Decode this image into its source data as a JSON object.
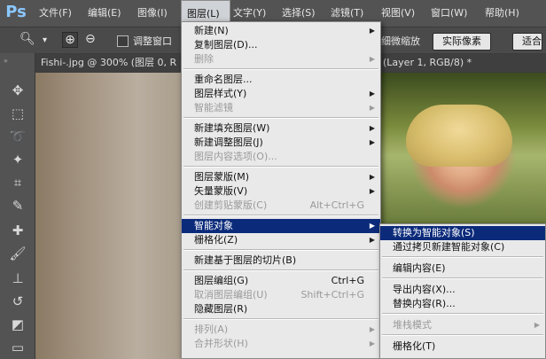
{
  "app": {
    "logo": "Ps",
    "menubar": [
      "文件(F)",
      "编辑(E)",
      "图像(I)",
      "图层(L)",
      "文字(Y)",
      "选择(S)",
      "滤镜(T)",
      "视图(V)",
      "窗口(W)",
      "帮助(H)"
    ],
    "active_menu_index": 3
  },
  "options_bar": {
    "checkbox_label": "调整窗口",
    "scrubby_zoom": "细微缩放",
    "actual_pixels": "实际像素",
    "fit_screen": "适合"
  },
  "tabs": {
    "doc1": "Fishi-.jpg @ 300% (图层 0, R",
    "doc2": "(Layer 1, RGB/8) *"
  },
  "toolbar_icons": [
    "move-icon",
    "marquee-icon",
    "lasso-icon",
    "magic-wand-icon",
    "crop-icon",
    "eyedropper-icon",
    "healing-icon",
    "brush-icon",
    "stamp-icon",
    "history-brush-icon",
    "eraser-icon"
  ],
  "layer_menu": {
    "items": [
      {
        "label": "新建(N)",
        "submenu": true,
        "disabled": false
      },
      {
        "label": "复制图层(D)...",
        "submenu": false,
        "disabled": false
      },
      {
        "label": "删除",
        "submenu": true,
        "disabled": true
      },
      {
        "sep": true
      },
      {
        "label": "重命名图层...",
        "submenu": false,
        "disabled": false
      },
      {
        "label": "图层样式(Y)",
        "submenu": true,
        "disabled": false
      },
      {
        "label": "智能滤镜",
        "submenu": true,
        "disabled": true
      },
      {
        "sep": true
      },
      {
        "label": "新建填充图层(W)",
        "submenu": true,
        "disabled": false
      },
      {
        "label": "新建调整图层(J)",
        "submenu": true,
        "disabled": false
      },
      {
        "label": "图层内容选项(O)...",
        "submenu": false,
        "disabled": true
      },
      {
        "sep": true
      },
      {
        "label": "图层蒙版(M)",
        "submenu": true,
        "disabled": false
      },
      {
        "label": "矢量蒙版(V)",
        "submenu": true,
        "disabled": false
      },
      {
        "label": "创建剪贴蒙版(C)",
        "shortcut": "Alt+Ctrl+G",
        "submenu": false,
        "disabled": true
      },
      {
        "sep": true
      },
      {
        "label": "智能对象",
        "submenu": true,
        "disabled": false,
        "highlight": true
      },
      {
        "label": "栅格化(Z)",
        "submenu": true,
        "disabled": false
      },
      {
        "sep": true
      },
      {
        "label": "新建基于图层的切片(B)",
        "submenu": false,
        "disabled": false
      },
      {
        "sep": true
      },
      {
        "label": "图层编组(G)",
        "shortcut": "Ctrl+G",
        "submenu": false,
        "disabled": false
      },
      {
        "label": "取消图层编组(U)",
        "shortcut": "Shift+Ctrl+G",
        "submenu": false,
        "disabled": true
      },
      {
        "label": "隐藏图层(R)",
        "submenu": false,
        "disabled": false
      },
      {
        "sep": true
      },
      {
        "label": "排列(A)",
        "submenu": true,
        "disabled": true
      },
      {
        "label": "合并形状(H)",
        "submenu": true,
        "disabled": true
      }
    ]
  },
  "smart_object_submenu": {
    "items": [
      {
        "label": "转换为智能对象(S)",
        "submenu": false,
        "disabled": false,
        "highlight": true
      },
      {
        "label": "通过拷贝新建智能对象(C)",
        "submenu": false,
        "disabled": false
      },
      {
        "sep": true
      },
      {
        "label": "编辑内容(E)",
        "submenu": false,
        "disabled": false
      },
      {
        "sep": true
      },
      {
        "label": "导出内容(X)...",
        "submenu": false,
        "disabled": false
      },
      {
        "label": "替换内容(R)...",
        "submenu": false,
        "disabled": false
      },
      {
        "sep": true
      },
      {
        "label": "堆栈模式",
        "submenu": true,
        "disabled": true
      },
      {
        "sep": true
      },
      {
        "label": "栅格化(T)",
        "submenu": false,
        "disabled": false
      }
    ]
  },
  "colors": {
    "menubar_bg": "#535353",
    "menu_bg": "#e9e9e9",
    "highlight": "#0b2a7a",
    "logo": "#8bc7ff"
  }
}
